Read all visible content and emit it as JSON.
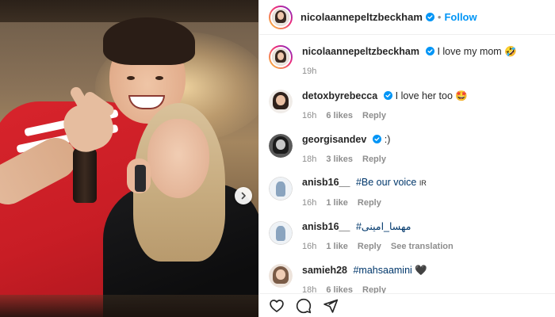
{
  "post": {
    "author": "nicolaannepeltzbeckham",
    "follow_label": "Follow",
    "separator": "•"
  },
  "comments": [
    {
      "username": "nicolaannepeltzbeckham",
      "verified": true,
      "text": "I love my mom",
      "emoji": "🤣",
      "time": "19h",
      "likes": "",
      "reply": "",
      "translate": ""
    },
    {
      "username": "detoxbyrebecca",
      "verified": true,
      "text": "I love her too",
      "emoji": "🤩",
      "time": "16h",
      "likes": "6 likes",
      "reply": "Reply",
      "translate": ""
    },
    {
      "username": "georgisandev",
      "verified": true,
      "text": ":)",
      "emoji": "",
      "time": "18h",
      "likes": "3 likes",
      "reply": "Reply",
      "translate": ""
    },
    {
      "username": "anisb16__",
      "verified": false,
      "text": "#Be our voice",
      "emoji": "IR",
      "time": "16h",
      "likes": "1 like",
      "reply": "Reply",
      "translate": ""
    },
    {
      "username": "anisb16__",
      "verified": false,
      "text": "#مهسا_امینی",
      "emoji": "",
      "time": "16h",
      "likes": "1 like",
      "reply": "Reply",
      "translate": "See translation"
    },
    {
      "username": "samieh28",
      "verified": false,
      "text": "#mahsaamini",
      "emoji": "🖤",
      "time": "18h",
      "likes": "6 likes",
      "reply": "Reply",
      "translate": ""
    }
  ],
  "icons": {
    "like": "heart-icon",
    "comment": "comment-icon",
    "share": "paper-plane-icon",
    "verified": "verified-badge-icon",
    "carousel": "chevron-right-icon"
  },
  "colors": {
    "link_blue": "#0095f6",
    "hashtag_blue": "#00376b",
    "muted": "#8e8e8e",
    "text": "#262626",
    "verified": "#0095f6"
  }
}
